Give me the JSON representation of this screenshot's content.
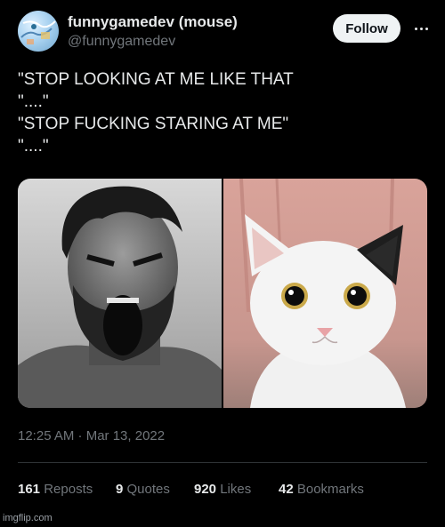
{
  "author": {
    "name": "funnygamedev (mouse)",
    "handle": "@funnygamedev",
    "avatar_icon": "map-avatar"
  },
  "actions": {
    "follow_label": "Follow",
    "more_icon": "more-dots-icon"
  },
  "tweet": {
    "lines": [
      "\"STOP LOOKING AT ME LIKE THAT",
      "\"....\"",
      "\"STOP FUCKING STARING AT ME\"",
      "\"....\""
    ]
  },
  "media": {
    "images": [
      "screaming-man-photo",
      "staring-cat-photo"
    ]
  },
  "meta": {
    "timestamp": "12:25 AM · Mar 13, 2022"
  },
  "stats": [
    {
      "count": "161",
      "label": "Reposts"
    },
    {
      "count": "9",
      "label": "Quotes"
    },
    {
      "count": "920",
      "label": "Likes"
    },
    {
      "count": "42",
      "label": "Bookmarks"
    }
  ],
  "watermark": "imgflip.com",
  "colors": {
    "background": "#000000",
    "text": "#e7e9ea",
    "muted": "#71767b",
    "follow_bg": "#eff3f4"
  }
}
